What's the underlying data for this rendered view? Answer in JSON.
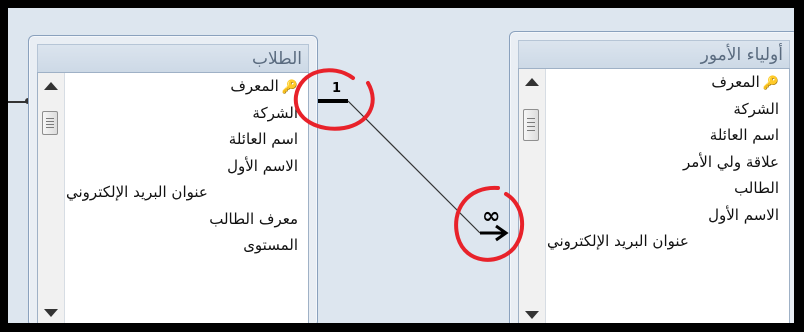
{
  "tables": {
    "students": {
      "title": "الطلاب",
      "fields": [
        "المعرف",
        "الشركة",
        "اسم العائلة",
        "الاسم الأول",
        "عنوان البريد الإلكتروني",
        "معرف الطالب",
        "المستوى"
      ],
      "primary_key_field": "المعرف"
    },
    "guardians": {
      "title": "أولياء الأمور",
      "fields": [
        "المعرف",
        "الشركة",
        "اسم العائلة",
        "علاقة ولي الأمر",
        "الطالب",
        "الاسم الأول",
        "عنوان البريد الإلكتروني"
      ],
      "primary_key_field": "المعرف"
    }
  },
  "relationship": {
    "one_label": "1",
    "many_label": "∞"
  },
  "icons": {
    "key": "key-icon",
    "scroll_up": "scroll-up-arrow-icon",
    "scroll_down": "scroll-down-arrow-icon"
  },
  "colors": {
    "annotation_red": "#e8222a",
    "background": "#dde6ef",
    "title_text": "#5a6b7f"
  }
}
